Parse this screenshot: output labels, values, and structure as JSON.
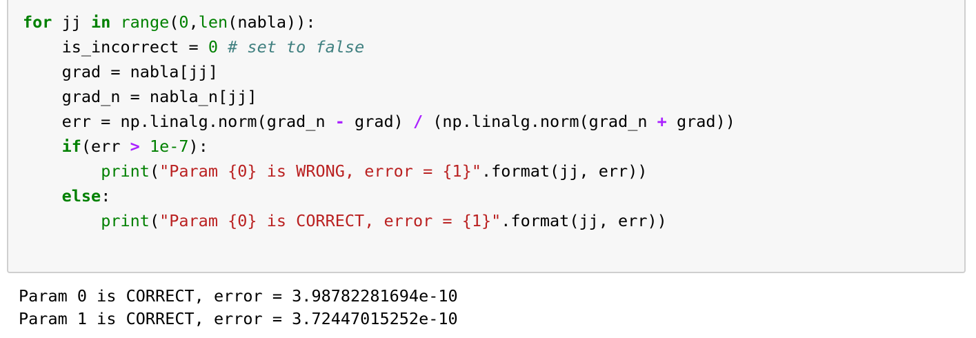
{
  "cell": {
    "code_lines": [
      [
        {
          "t": "for",
          "c": "kw"
        },
        {
          "t": " jj ",
          "c": ""
        },
        {
          "t": "in",
          "c": "kw"
        },
        {
          "t": " ",
          "c": ""
        },
        {
          "t": "range",
          "c": "bi"
        },
        {
          "t": "(",
          "c": ""
        },
        {
          "t": "0",
          "c": "num"
        },
        {
          "t": ",",
          "c": ""
        },
        {
          "t": "len",
          "c": "bi"
        },
        {
          "t": "(nabla)):",
          "c": ""
        }
      ],
      [
        {
          "t": "    is_incorrect = ",
          "c": ""
        },
        {
          "t": "0",
          "c": "num"
        },
        {
          "t": " ",
          "c": ""
        },
        {
          "t": "# set to false",
          "c": "com"
        }
      ],
      [
        {
          "t": "    grad = nabla[jj]",
          "c": ""
        }
      ],
      [
        {
          "t": "    grad_n = nabla_n[jj]",
          "c": ""
        }
      ],
      [
        {
          "t": "    err = np.linalg.norm(grad_n ",
          "c": ""
        },
        {
          "t": "-",
          "c": "op"
        },
        {
          "t": " grad) ",
          "c": ""
        },
        {
          "t": "/",
          "c": "op"
        },
        {
          "t": " (np.linalg.norm(grad_n ",
          "c": ""
        },
        {
          "t": "+",
          "c": "op"
        },
        {
          "t": " grad))",
          "c": ""
        }
      ],
      [
        {
          "t": "    ",
          "c": ""
        },
        {
          "t": "if",
          "c": "kw"
        },
        {
          "t": "(err ",
          "c": ""
        },
        {
          "t": ">",
          "c": "op"
        },
        {
          "t": " ",
          "c": ""
        },
        {
          "t": "1e-7",
          "c": "num"
        },
        {
          "t": "):",
          "c": ""
        }
      ],
      [
        {
          "t": "        ",
          "c": ""
        },
        {
          "t": "print",
          "c": "bi"
        },
        {
          "t": "(",
          "c": ""
        },
        {
          "t": "\"Param {0} is WRONG, error = {1}\"",
          "c": "str"
        },
        {
          "t": ".format(jj, err))",
          "c": ""
        }
      ],
      [
        {
          "t": "    ",
          "c": ""
        },
        {
          "t": "else",
          "c": "kw"
        },
        {
          "t": ":",
          "c": ""
        }
      ],
      [
        {
          "t": "        ",
          "c": ""
        },
        {
          "t": "print",
          "c": "bi"
        },
        {
          "t": "(",
          "c": ""
        },
        {
          "t": "\"Param {0} is CORRECT, error = {1}\"",
          "c": "str"
        },
        {
          "t": ".format(jj, err))",
          "c": ""
        }
      ]
    ],
    "output_lines": [
      "Param 0 is CORRECT, error = 3.98782281694e-10",
      "Param 1 is CORRECT, error = 3.72447015252e-10"
    ]
  },
  "colors": {
    "keyword": "#008000",
    "string": "#ba2121",
    "comment": "#408080",
    "operator": "#aa22ff",
    "cell_background": "#f7f7f7",
    "cell_border": "#cfcfcf"
  }
}
